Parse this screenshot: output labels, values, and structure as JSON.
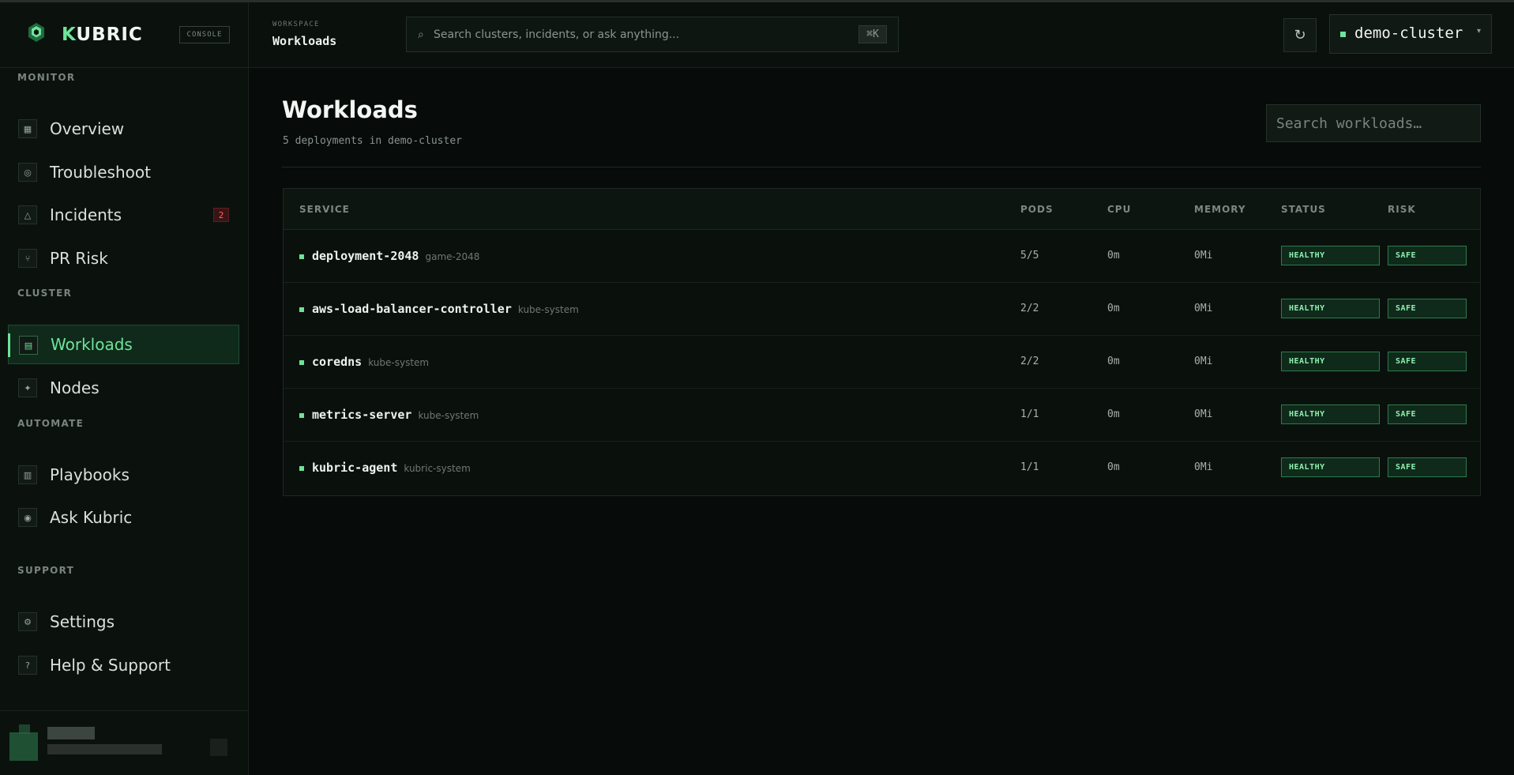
{
  "brand": {
    "name_accent": "K",
    "name_rest": "UBRIC",
    "badge": "CONSOLE"
  },
  "sidebar": {
    "sections": [
      {
        "label": "MONITOR"
      },
      {
        "label": "CLUSTER"
      },
      {
        "label": "AUTOMATE"
      },
      {
        "label": "SUPPORT"
      }
    ],
    "items": [
      {
        "label": "Overview",
        "icon": "grid-icon"
      },
      {
        "label": "Troubleshoot",
        "icon": "target-icon"
      },
      {
        "label": "Incidents",
        "icon": "triangle-icon",
        "badge": "2"
      },
      {
        "label": "PR Risk",
        "icon": "branch-icon"
      },
      {
        "label": "Workloads",
        "icon": "list-icon",
        "active": true
      },
      {
        "label": "Nodes",
        "icon": "sparkle-icon"
      },
      {
        "label": "Playbooks",
        "icon": "book-icon"
      },
      {
        "label": "Ask Kubric",
        "icon": "dot-icon"
      },
      {
        "label": "Settings",
        "icon": "gear-icon"
      },
      {
        "label": "Help & Support",
        "icon": "question-icon"
      }
    ]
  },
  "topbar": {
    "workspace_label": "WORKSPACE",
    "workspace_title": "Workloads",
    "search_placeholder": "Search clusters, incidents, or ask anything...",
    "search_shortcut": "⌘K",
    "cluster_name": "demo-cluster",
    "accent_color": "#6fe39a"
  },
  "main": {
    "title": "Workloads",
    "subtitle": "5 deployments in demo-cluster",
    "search_placeholder": "Search workloads…",
    "columns": [
      "SERVICE",
      "PODS",
      "CPU",
      "MEMORY",
      "STATUS",
      "RISK"
    ],
    "rows": [
      {
        "name": "deployment-2048",
        "namespace": "game-2048",
        "pods": "5/5",
        "cpu": "0m",
        "memory": "0Mi",
        "status": "HEALTHY",
        "risk": "SAFE"
      },
      {
        "name": "aws-load-balancer-controller",
        "namespace": "kube-system",
        "pods": "2/2",
        "cpu": "0m",
        "memory": "0Mi",
        "status": "HEALTHY",
        "risk": "SAFE"
      },
      {
        "name": "coredns",
        "namespace": "kube-system",
        "pods": "2/2",
        "cpu": "0m",
        "memory": "0Mi",
        "status": "HEALTHY",
        "risk": "SAFE"
      },
      {
        "name": "metrics-server",
        "namespace": "kube-system",
        "pods": "1/1",
        "cpu": "0m",
        "memory": "0Mi",
        "status": "HEALTHY",
        "risk": "SAFE"
      },
      {
        "name": "kubric-agent",
        "namespace": "kubric-system",
        "pods": "1/1",
        "cpu": "0m",
        "memory": "0Mi",
        "status": "HEALTHY",
        "risk": "SAFE"
      }
    ]
  }
}
